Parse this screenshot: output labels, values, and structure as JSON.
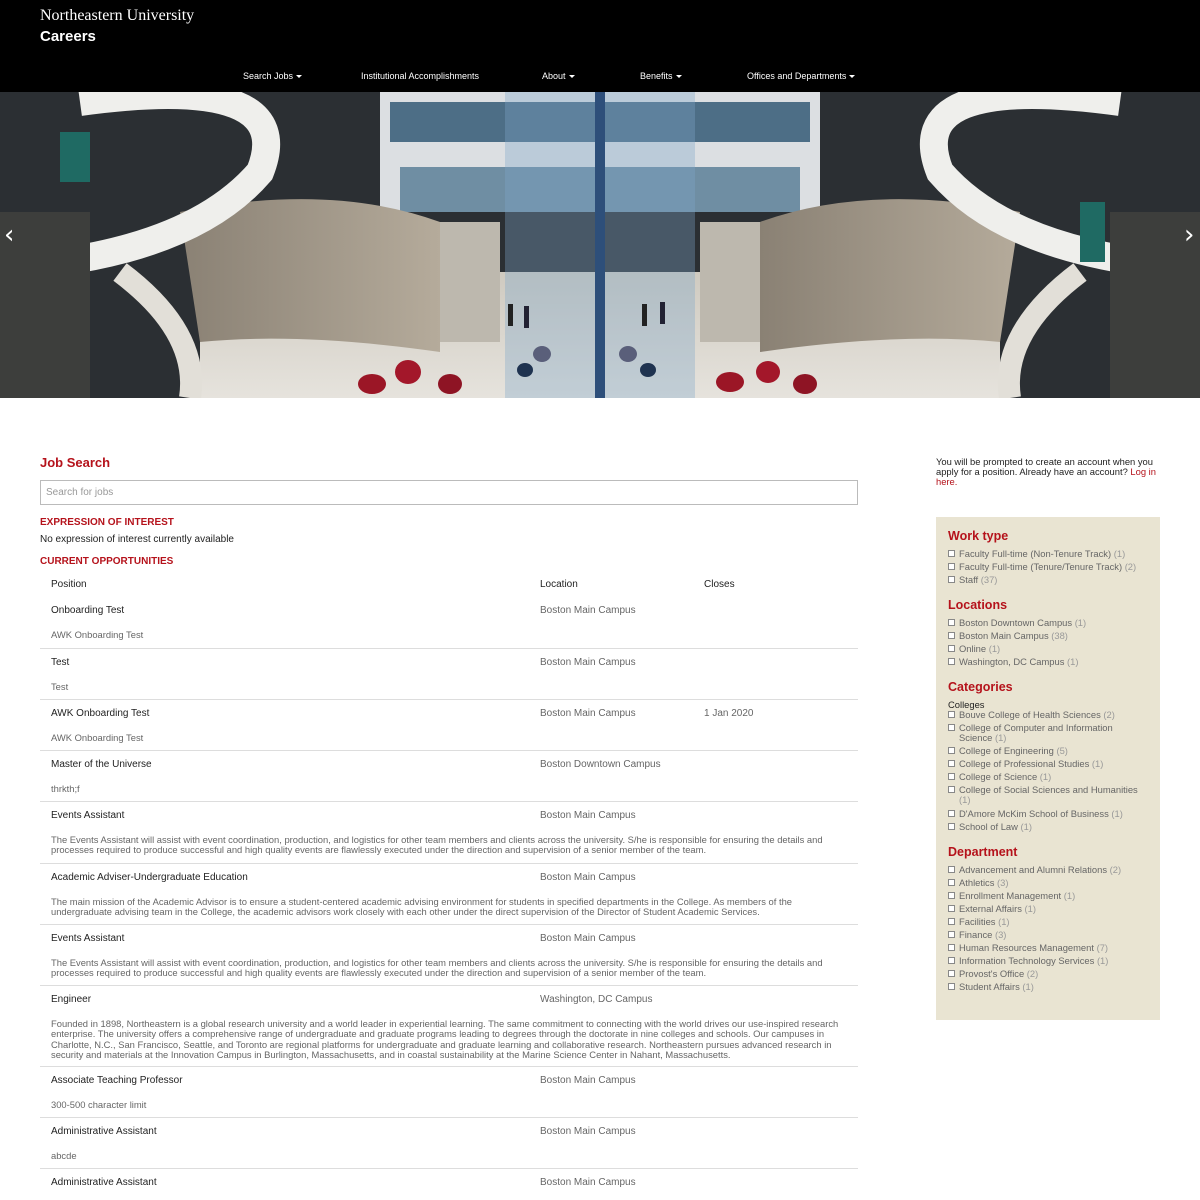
{
  "header": {
    "university": "Northeastern University",
    "site": "Careers",
    "nav": [
      {
        "label": "Search Jobs",
        "dropdown": true
      },
      {
        "label": "Institutional Accomplishments",
        "dropdown": false
      },
      {
        "label": "About",
        "dropdown": true
      },
      {
        "label": "Benefits",
        "dropdown": true
      },
      {
        "label": "Offices and Departments",
        "dropdown": true
      }
    ]
  },
  "hero": {
    "prev": "‹",
    "next": "›"
  },
  "job_search": {
    "title": "Job Search",
    "search_placeholder": "Search for jobs",
    "expression_heading": "EXPRESSION OF INTEREST",
    "expression_text": "No expression of interest currently available",
    "current_heading": "CURRENT OPPORTUNITIES",
    "columns": {
      "position": "Position",
      "location": "Location",
      "closes": "Closes"
    },
    "jobs": [
      {
        "title": "Onboarding Test",
        "location": "Boston Main Campus",
        "closes": "",
        "desc": "AWK Onboarding Test"
      },
      {
        "title": "Test",
        "location": "Boston Main Campus",
        "closes": "",
        "desc": "Test"
      },
      {
        "title": "AWK Onboarding Test",
        "location": "Boston Main Campus",
        "closes": "1 Jan 2020",
        "desc": "AWK Onboarding Test"
      },
      {
        "title": "Master of the Universe",
        "location": "Boston Downtown Campus",
        "closes": "",
        "desc": "thrkth;f"
      },
      {
        "title": "Events Assistant",
        "location": "Boston Main Campus",
        "closes": "",
        "desc": "The Events Assistant will assist with event coordination, production, and logistics for other team members and clients across the university. S/he is responsible for ensuring the details and processes required to produce successful and high quality events are flawlessly executed under the direction and supervision of a senior member of the team."
      },
      {
        "title": "Academic Adviser-Undergraduate Education",
        "location": "Boston Main Campus",
        "closes": "",
        "desc": "The main mission of the Academic Advisor is to ensure a student-centered academic advising environment for students in specified departments in the College. As members of the undergraduate advising team in the College, the academic advisors work closely with each other under the direct supervision of the Director of Student Academic Services."
      },
      {
        "title": "Events Assistant",
        "location": "Boston Main Campus",
        "closes": "",
        "desc": "The Events Assistant will assist with event coordination, production, and logistics for other team members and clients across the university. S/he is responsible for ensuring the details and processes required to produce successful and high quality events are flawlessly executed under the direction and supervision of a senior member of the team."
      },
      {
        "title": "Engineer",
        "location": "Washington, DC Campus",
        "closes": "",
        "desc": "Founded in 1898, Northeastern is a global research university and a world leader in experiential learning. The same commitment to connecting with the world drives our use-inspired research enterprise. The university offers a comprehensive range of undergraduate and graduate programs leading to degrees through the doctorate in nine colleges and schools. Our campuses in Charlotte, N.C., San Francisco, Seattle, and Toronto are regional platforms for undergraduate and graduate learning and collaborative research. Northeastern pursues advanced research in security and materials at the Innovation Campus in Burlington, Massachusetts, and in coastal sustainability at the Marine Science Center in Nahant, Massachusetts."
      },
      {
        "title": "Associate Teaching Professor",
        "location": "Boston Main Campus",
        "closes": "",
        "desc": "300-500 character limit"
      },
      {
        "title": "Administrative Assistant",
        "location": "Boston Main Campus",
        "closes": "",
        "desc": "abcde"
      },
      {
        "title": "Administrative Assistant",
        "location": "Boston Main Campus",
        "closes": "",
        "desc": ""
      }
    ]
  },
  "sidebar": {
    "account_note": "You will be prompted to create an account when you apply for a position. Already have an account?",
    "login_link": "Log in here.",
    "work_type": {
      "heading": "Work type",
      "items": [
        {
          "label": "Faculty Full-time (Non-Tenure Track)",
          "count": "(1)"
        },
        {
          "label": "Faculty Full-time (Tenure/Tenure Track)",
          "count": "(2)"
        },
        {
          "label": "Staff",
          "count": "(37)"
        }
      ]
    },
    "locations": {
      "heading": "Locations",
      "items": [
        {
          "label": "Boston Downtown Campus",
          "count": "(1)"
        },
        {
          "label": "Boston Main Campus",
          "count": "(38)"
        },
        {
          "label": "Online",
          "count": "(1)"
        },
        {
          "label": "Washington, DC Campus",
          "count": "(1)"
        }
      ]
    },
    "categories": {
      "heading": "Categories",
      "group": "Colleges",
      "items": [
        {
          "label": "Bouve College of Health Sciences",
          "count": "(2)"
        },
        {
          "label": "College of Computer and Information Science",
          "count": "(1)"
        },
        {
          "label": "College of Engineering",
          "count": "(5)"
        },
        {
          "label": "College of Professional Studies",
          "count": "(1)"
        },
        {
          "label": "College of Science",
          "count": "(1)"
        },
        {
          "label": "College of Social Sciences and Humanities",
          "count": "(1)"
        },
        {
          "label": "D'Amore McKim School of Business",
          "count": "(1)"
        },
        {
          "label": "School of Law",
          "count": "(1)"
        }
      ]
    },
    "department": {
      "heading": "Department",
      "items": [
        {
          "label": "Advancement and Alumni Relations",
          "count": "(2)"
        },
        {
          "label": "Athletics",
          "count": "(3)"
        },
        {
          "label": "Enrollment Management",
          "count": "(1)"
        },
        {
          "label": "External Affairs",
          "count": "(1)"
        },
        {
          "label": "Facilities",
          "count": "(1)"
        },
        {
          "label": "Finance",
          "count": "(3)"
        },
        {
          "label": "Human Resources Management",
          "count": "(7)"
        },
        {
          "label": "Information Technology Services",
          "count": "(1)"
        },
        {
          "label": "Provost's Office",
          "count": "(2)"
        },
        {
          "label": "Student Affairs",
          "count": "(1)"
        }
      ]
    }
  }
}
